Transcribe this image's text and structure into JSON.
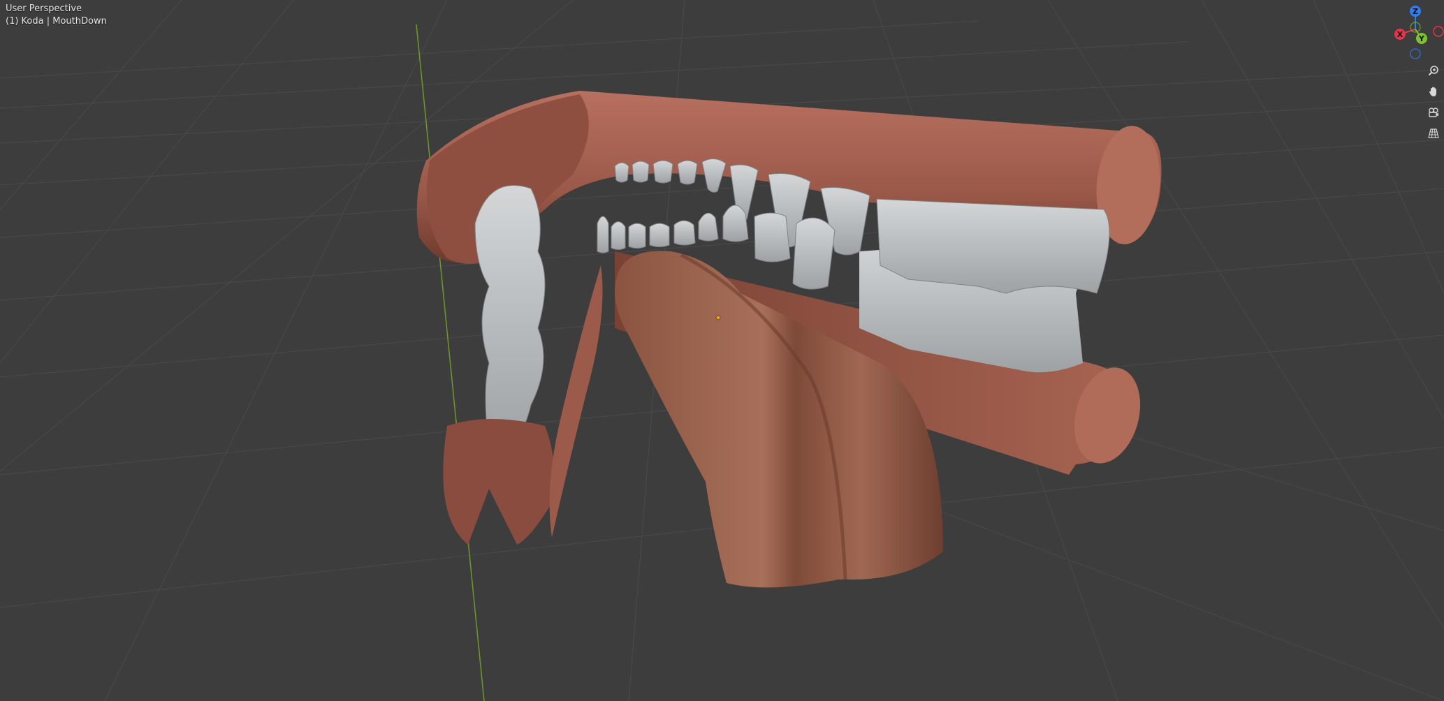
{
  "viewport": {
    "view_name": "User Perspective",
    "object_info": "(1) Koda | MouthDown",
    "background_color": "#3d3d3d"
  },
  "gizmo": {
    "axes": [
      {
        "label": "Z",
        "color": "#2e7ef0"
      },
      {
        "label": "X",
        "color": "#e8334c"
      },
      {
        "label": "Y",
        "color": "#7cc230"
      }
    ]
  },
  "nav_tools": [
    {
      "name": "zoom",
      "icon": "magnifier-plus-icon"
    },
    {
      "name": "pan",
      "icon": "hand-icon"
    },
    {
      "name": "camera-view",
      "icon": "camera-icon"
    },
    {
      "name": "ortho-toggle",
      "icon": "grid-icon"
    }
  ],
  "colors": {
    "gum": "#a86452",
    "teeth": "#b8bcbe",
    "grid_line": "#4a4a4a",
    "y_axis_line": "#6f9a2a",
    "origin": "#f0a020"
  }
}
